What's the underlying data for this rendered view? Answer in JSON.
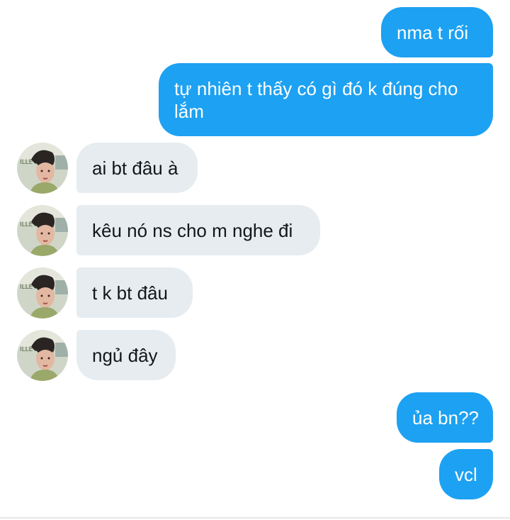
{
  "messages": [
    {
      "side": "out",
      "text": "nma t rối"
    },
    {
      "side": "out",
      "text": "tự nhiên t thấy có gì đó k đúng cho lắm"
    },
    {
      "side": "in",
      "text": "ai bt đâu à",
      "avatar": "user-avatar"
    },
    {
      "side": "in",
      "text": "kêu nó ns cho m nghe đi",
      "avatar": "user-avatar"
    },
    {
      "side": "in",
      "text": "t k bt đâu",
      "avatar": "user-avatar"
    },
    {
      "side": "in",
      "text": "ngủ đây",
      "avatar": "user-avatar"
    },
    {
      "side": "out",
      "text": "ủa bn??"
    },
    {
      "side": "out",
      "text": "vcl"
    }
  ],
  "colors": {
    "outgoing_bubble": "#1da1f2",
    "incoming_bubble": "#e6ecf0",
    "incoming_text": "#14171a",
    "outgoing_text": "#ffffff"
  }
}
